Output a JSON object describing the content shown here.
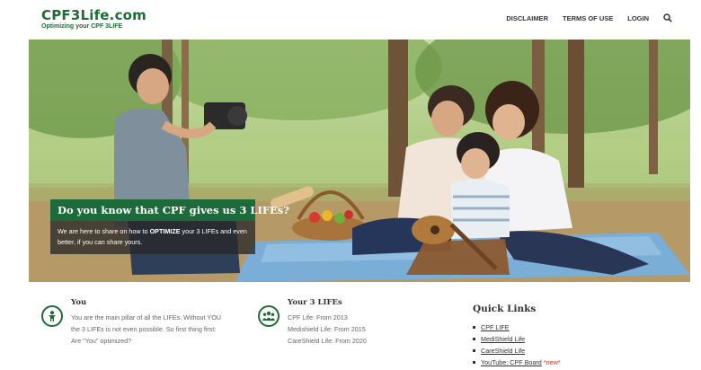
{
  "header": {
    "logo_title": "CPF3Life.com",
    "logo_tagline": "Optimizing your CPF 3LIFE",
    "nav": {
      "disclaimer": "DISCLAIMER",
      "terms": "TERMS OF USE",
      "login": "LOGIN"
    },
    "search_icon": "search-icon"
  },
  "hero": {
    "title": "Do you know that CPF gives us 3 LIFEs?",
    "body_pre": "We are here to share on how to ",
    "body_strong": "OPTIMIZE",
    "body_post": " your 3 LIFEs and even better, if you can share yours."
  },
  "you": {
    "icon": "person-icon",
    "title": "You",
    "lines": [
      "You are the main pillar of all the LIFEs. Without YOU",
      "the 3 LIFEs is not even possible. So first thing first:",
      "Are \"You\" optimized?"
    ]
  },
  "lifes": {
    "icon": "group-icon",
    "title": "Your 3 LIFEs",
    "lines": [
      "CPF Life: From 2013",
      "Medishield Life: From 2015",
      "CareShield Life: From 2020"
    ]
  },
  "quick_links": {
    "title": "Quick Links",
    "items": [
      {
        "label": "CPF LIFE",
        "badge": ""
      },
      {
        "label": "MediShield Life",
        "badge": ""
      },
      {
        "label": "CareShield Life",
        "badge": ""
      },
      {
        "label": "YouTube: CPF Board",
        "badge": "*new*"
      }
    ]
  },
  "colors": {
    "brand_green": "#1f6b35",
    "caption_green": "#1d6b3a",
    "new_badge": "#c0392b"
  }
}
